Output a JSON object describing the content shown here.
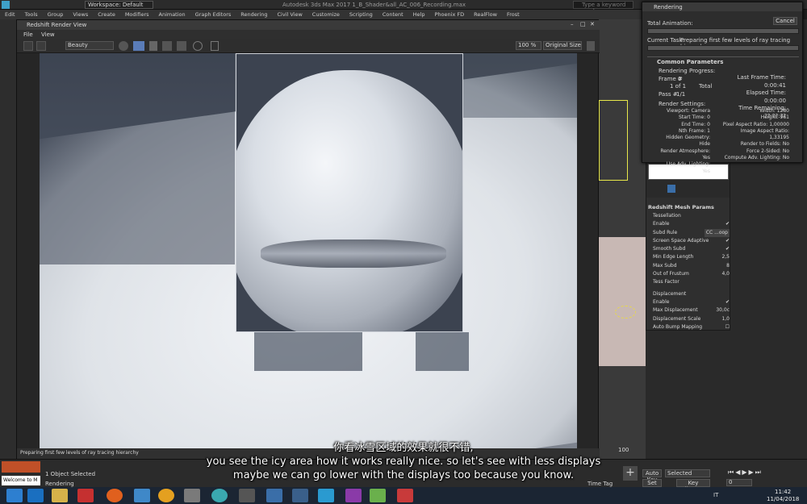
{
  "titlebar": {
    "workspace": "Workspace: Default",
    "app_title": "Autodesk 3ds Max 2017    1_B_Shader&all_AC_006_Recording.max",
    "search_placeholder": "Type a keyword or phrase"
  },
  "menubar": [
    "Edit",
    "Tools",
    "Group",
    "Views",
    "Create",
    "Modifiers",
    "Animation",
    "Graph Editors",
    "Rendering",
    "Civil View",
    "Customize",
    "Scripting",
    "Content",
    "Help",
    "Phoenix FD",
    "RealFlow",
    "Frost"
  ],
  "render_view": {
    "title": "Redshift Render View",
    "menu": [
      "File",
      "View"
    ],
    "channel": "Beauty",
    "zoom": "100 %",
    "size_mode": "Original Size",
    "status": "Preparing first few levels of ray tracing hierarchy"
  },
  "rendering_dialog": {
    "title": "Rendering",
    "total_animation_label": "Total Animation:",
    "cancel": "Cancel",
    "current_task_label": "Current Task:",
    "current_task": "Preparing first few levels of ray tracing hierarchy",
    "common_parameters": "Common Parameters",
    "rendering_progress": "Rendering Progress:",
    "frame_label": "Frame #",
    "frame_value": "0",
    "of_label": "1 of 1",
    "total_label": "Total",
    "pass_label": "Pass #",
    "pass_value": "1/1",
    "last_frame_time_label": "Last Frame Time:",
    "last_frame_time": "0:00:41",
    "elapsed_time_label": "Elapsed Time:",
    "elapsed_time": "0:00:00",
    "time_remaining_label": "Time Remaining:",
    "time_remaining": "??:??:??",
    "render_settings": "Render Settings:",
    "settings_left": [
      [
        "Viewport:",
        "Camera"
      ],
      [
        "Start Time:",
        "0"
      ],
      [
        "End Time:",
        "0"
      ],
      [
        "Nth Frame:",
        "1"
      ],
      [
        "Hidden Geometry:",
        "Hide"
      ],
      [
        "Render Atmosphere:",
        "Yes"
      ],
      [
        "Use Adv. Lighting:",
        "Yes"
      ]
    ],
    "settings_right": [
      [
        "Width:",
        "1280"
      ],
      [
        "Height:",
        "961"
      ],
      [
        "Pixel Aspect Ratio:",
        "1,00000"
      ],
      [
        "Image Aspect Ratio:",
        "1,33195"
      ],
      [
        "Render to Fields:",
        "No"
      ],
      [
        "Force 2-Sided:",
        "No"
      ],
      [
        "Compute Adv. Lighting:",
        "No"
      ]
    ]
  },
  "mesh_params": {
    "title": "Redshift Mesh Params",
    "tessellation": "Tessellation",
    "enable": "Enable",
    "subd_rule": "Subd Rule",
    "subd_rule_value": "CC ...oop",
    "screen_space_adaptive": "Screen Space Adaptive",
    "smooth_subd": "Smooth Subd",
    "min_edge_length": "Min Edge Length",
    "min_edge_length_value": "2,5",
    "max_subd": "Max Subd",
    "max_subd_value": "8",
    "out_of_frustum": "Out of Frustum",
    "tess_factor": "Tess Factor",
    "out_of_frustum_value": "4,0",
    "displacement": "Displacement",
    "disp_enable": "Enable",
    "max_displacement": "Max Displacement",
    "max_displacement_value": "30,0c",
    "displacement_scale": "Displacement Scale",
    "displacement_scale_value": "1,0",
    "auto_bump": "Auto Bump Mapping"
  },
  "bottom": {
    "objects_selected": "1 Object Selected",
    "rendering_label": "Rendering",
    "welcome": "Welcome to M",
    "timeline_end": "100",
    "auto_key": "Auto Key",
    "set_key": "Set Key",
    "selected": "Selected",
    "key_filters": "Key Filters...",
    "time_tag": "Time Tag",
    "frame_field": "0"
  },
  "taskbar": {
    "lang": "IT",
    "time": "11:42",
    "date": "11/04/2018"
  },
  "subtitle": {
    "zh": "你看冰雪区域的效果就很不错,",
    "en1": "you see the icy area how it works really nice. so let's see with less displays",
    "en2": "maybe we can go lower with the displays too because you know."
  },
  "colors": {
    "accent_blue": "#3a6ea8",
    "selection_yellow": "#e8e84a"
  }
}
